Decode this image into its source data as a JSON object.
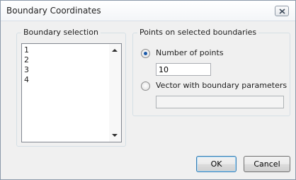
{
  "window": {
    "title": "Boundary Coordinates",
    "close_icon": "close-icon"
  },
  "boundary_selection": {
    "label": "Boundary selection",
    "items": [
      "1",
      "2",
      "3",
      "4"
    ]
  },
  "points": {
    "label": "Points on selected boundaries",
    "option_number": {
      "label": "Number of points",
      "selected": true,
      "value": "10"
    },
    "option_vector": {
      "label": "Vector with boundary parameters",
      "selected": false,
      "value": ""
    }
  },
  "buttons": {
    "ok": "OK",
    "cancel": "Cancel"
  },
  "colors": {
    "radio_selected": "#1a59a8",
    "default_button_border": "#3c7fb1"
  }
}
